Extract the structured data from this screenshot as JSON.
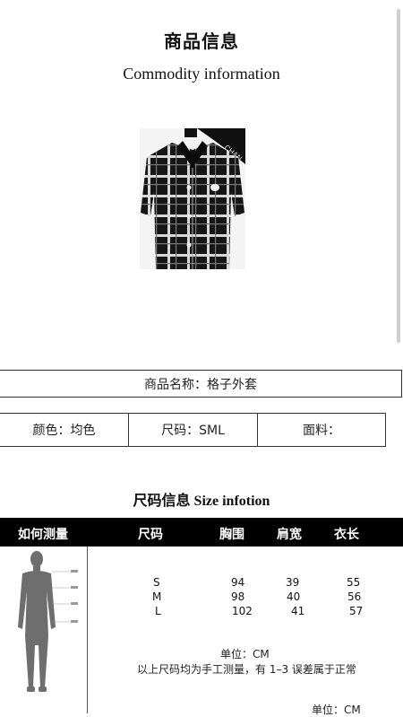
{
  "header": {
    "title_cn": "商品信息",
    "title_en": "Commodity information"
  },
  "product": {
    "image_alt": "CHAN",
    "name_text": "商品名称：格子外套"
  },
  "attributes": [
    {
      "text": "颜色：均色"
    },
    {
      "text": "尺码：SML"
    },
    {
      "text": "面料："
    }
  ],
  "size_section": {
    "title": "尺码信息 Size infotion",
    "headers": [
      "如何测量",
      "尺码",
      "胸围",
      "肩宽",
      "衣长"
    ],
    "rows": [
      {
        "size": "S",
        "chest": "94",
        "shoulder": "39",
        "length": "55"
      },
      {
        "size": "M",
        "chest": "98",
        "shoulder": "40",
        "length": "56"
      },
      {
        "size": "L",
        "chest": "102",
        "shoulder": "41",
        "length": "57"
      }
    ],
    "unit_note": "单位：CM",
    "accuracy_note": "以上尺码均为手工测量，有 1–3 误差属于正常",
    "bottom_unit": "单位：CM"
  },
  "colors": {
    "header_bg": "#000000",
    "text": "#111111",
    "figure_gray": "#6e6e6e"
  }
}
